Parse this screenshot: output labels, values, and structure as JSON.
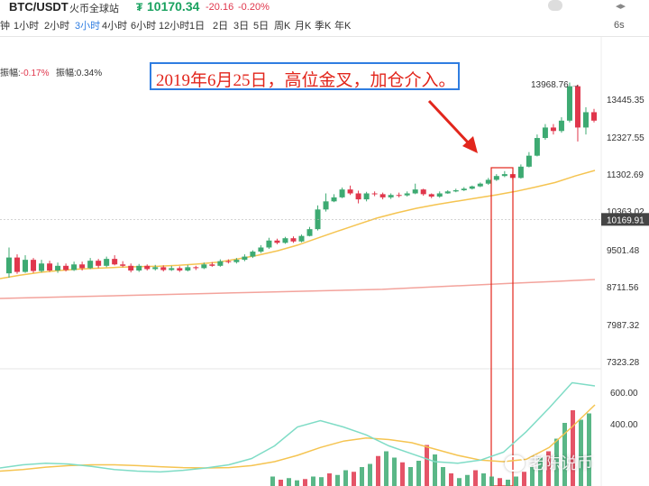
{
  "header": {
    "pair": "BTC/USDT",
    "exchange": "火币全球站",
    "price_icon": "₮",
    "price": "10170.34",
    "change": "-20.16",
    "change_pct": "-0.20%",
    "refresh": "6s"
  },
  "tabs": [
    {
      "label": "钟",
      "active": false
    },
    {
      "label": "1小时",
      "active": false
    },
    {
      "label": "2小时",
      "active": false
    },
    {
      "label": "3小时",
      "active": true
    },
    {
      "label": "4小时",
      "active": false
    },
    {
      "label": "6小时",
      "active": false
    },
    {
      "label": "12小时",
      "active": false
    },
    {
      "label": "1日",
      "active": false
    },
    {
      "label": "2日",
      "active": false
    },
    {
      "label": "3日",
      "active": false
    },
    {
      "label": "5日",
      "active": false
    },
    {
      "label": "周K",
      "active": false
    },
    {
      "label": "月K",
      "active": false
    },
    {
      "label": "季K",
      "active": false
    },
    {
      "label": "年K",
      "active": false
    }
  ],
  "amplitude": {
    "label1": "振幅:",
    "value1": "-0.17%",
    "label2": "振幅:",
    "value2": "0.34%"
  },
  "annotation": "2019年6月25日，高位金叉，加仓介入。",
  "watermark": "老陈说币",
  "colors": {
    "up": "#3daa72",
    "down": "#e0364c",
    "ma_short": "#f5c451",
    "ma_long": "#f3a39c",
    "annotation_border": "#2f7de1",
    "highlight": "#e2261c",
    "indicator_fast": "#7fdcc6",
    "indicator_slow": "#f5c451"
  },
  "chart_data": {
    "type": "candlestick",
    "y_ticks": [
      13445.35,
      12327.55,
      11302.69,
      10363.02,
      9501.48,
      8711.56,
      7987.32,
      7323.28
    ],
    "ylim": [
      7323.28,
      13968.76
    ],
    "current_price": "10169.91",
    "high_label": "13968.76",
    "candles": [
      [
        8990,
        9330,
        9550,
        8900
      ],
      [
        9330,
        9020,
        9400,
        8980
      ],
      [
        9020,
        9280,
        9380,
        9000
      ],
      [
        9280,
        9040,
        9320,
        9000
      ],
      [
        9040,
        9200,
        9280,
        9010
      ],
      [
        9200,
        9050,
        9260,
        9020
      ],
      [
        9050,
        9150,
        9220,
        9000
      ],
      [
        9150,
        9060,
        9200,
        9030
      ],
      [
        9060,
        9180,
        9240,
        9040
      ],
      [
        9180,
        9100,
        9240,
        9050
      ],
      [
        9100,
        9260,
        9320,
        9080
      ],
      [
        9260,
        9150,
        9300,
        9100
      ],
      [
        9150,
        9300,
        9350,
        9120
      ],
      [
        9300,
        9180,
        9380,
        9160
      ],
      [
        9180,
        9150,
        9250,
        9120
      ],
      [
        9150,
        9050,
        9200,
        9010
      ],
      [
        9050,
        9150,
        9190,
        9020
      ],
      [
        9150,
        9080,
        9180,
        9050
      ],
      [
        9080,
        9120,
        9170,
        9050
      ],
      [
        9120,
        9060,
        9160,
        9030
      ],
      [
        9060,
        9100,
        9150,
        9040
      ],
      [
        9100,
        9050,
        9140,
        9020
      ],
      [
        9050,
        9120,
        9170,
        9030
      ],
      [
        9120,
        9100,
        9150,
        9060
      ],
      [
        9100,
        9180,
        9220,
        9080
      ],
      [
        9180,
        9150,
        9230,
        9130
      ],
      [
        9150,
        9250,
        9290,
        9130
      ],
      [
        9250,
        9230,
        9290,
        9200
      ],
      [
        9230,
        9280,
        9320,
        9200
      ],
      [
        9280,
        9350,
        9400,
        9250
      ],
      [
        9350,
        9460,
        9490,
        9320
      ],
      [
        9460,
        9550,
        9600,
        9430
      ],
      [
        9550,
        9700,
        9760,
        9520
      ],
      [
        9700,
        9650,
        9740,
        9620
      ],
      [
        9650,
        9750,
        9780,
        9630
      ],
      [
        9750,
        9680,
        9790,
        9650
      ],
      [
        9680,
        9800,
        9830,
        9660
      ],
      [
        9800,
        9950,
        10000,
        9790
      ],
      [
        9950,
        10400,
        10500,
        9920
      ],
      [
        10400,
        10600,
        10800,
        10350
      ],
      [
        10600,
        10700,
        10780,
        10580
      ],
      [
        10700,
        10900,
        10950,
        10680
      ],
      [
        10900,
        10800,
        11000,
        10760
      ],
      [
        10800,
        10650,
        10870,
        10550
      ],
      [
        10650,
        10800,
        10840,
        10600
      ],
      [
        10800,
        10780,
        10850,
        10730
      ],
      [
        10780,
        10700,
        10820,
        10650
      ],
      [
        10700,
        10760,
        10800,
        10660
      ],
      [
        10760,
        10750,
        10820,
        10700
      ],
      [
        10750,
        10800,
        10850,
        10720
      ],
      [
        10800,
        10900,
        11050,
        10780
      ],
      [
        10900,
        10780,
        10920,
        10740
      ],
      [
        10780,
        10720,
        10800,
        10680
      ],
      [
        10720,
        10800,
        10850,
        10690
      ],
      [
        10800,
        10850,
        10880,
        10790
      ],
      [
        10850,
        10880,
        10920,
        10830
      ],
      [
        10880,
        10920,
        10960,
        10860
      ],
      [
        10920,
        10980,
        11000,
        10900
      ],
      [
        10980,
        11050,
        11080,
        10960
      ],
      [
        11050,
        11150,
        11200,
        11020
      ],
      [
        11150,
        11250,
        11300,
        11120
      ],
      [
        11250,
        11300,
        11380,
        11220
      ],
      [
        11300,
        11200,
        11360,
        11150
      ],
      [
        11200,
        11500,
        11560,
        11180
      ],
      [
        11500,
        11800,
        11900,
        11480
      ],
      [
        11800,
        12300,
        12400,
        11780
      ],
      [
        12300,
        12600,
        12700,
        12250
      ],
      [
        12600,
        12500,
        12700,
        12400
      ],
      [
        12500,
        12800,
        12900,
        12450
      ],
      [
        12800,
        13850,
        13968.76,
        12750
      ],
      [
        13850,
        12600,
        13900,
        12200
      ],
      [
        12600,
        13050,
        13200,
        12400
      ],
      [
        13050,
        12800,
        13150,
        12750
      ]
    ],
    "ma_short": [
      8880,
      8950,
      9010,
      9050,
      9080,
      9100,
      9120,
      9130,
      9140,
      9160,
      9190,
      9230,
      9300,
      9380,
      9480,
      9600,
      9750,
      9900,
      10050,
      10200,
      10320,
      10430,
      10520,
      10600,
      10680,
      10760,
      10850,
      10960,
      11080,
      11250,
      11400
    ],
    "ma_long": [
      8480,
      8500,
      8520,
      8540,
      8560,
      8580,
      8600,
      8620,
      8640,
      8660,
      8700,
      8740,
      8780,
      8820,
      8860
    ],
    "indicator_ticks": [
      600,
      400
    ],
    "indicator_fast": [
      120,
      140,
      150,
      145,
      130,
      110,
      100,
      95,
      105,
      120,
      140,
      180,
      260,
      380,
      420,
      380,
      330,
      260,
      210,
      160,
      150,
      170,
      220,
      350,
      500,
      660,
      640
    ],
    "indicator_slow": [
      100,
      110,
      125,
      135,
      140,
      140,
      135,
      128,
      122,
      120,
      122,
      135,
      160,
      200,
      250,
      290,
      310,
      300,
      280,
      240,
      200,
      170,
      160,
      175,
      250,
      380,
      520
    ],
    "volumes": [
      30,
      20,
      25,
      18,
      22,
      30,
      28,
      40,
      35,
      50,
      45,
      60,
      70,
      95,
      110,
      90,
      75,
      60,
      80,
      130,
      100,
      60,
      40,
      25,
      35,
      50,
      40,
      30,
      25,
      20,
      30,
      45,
      60,
      90,
      110,
      150,
      200,
      240,
      210,
      230
    ]
  }
}
